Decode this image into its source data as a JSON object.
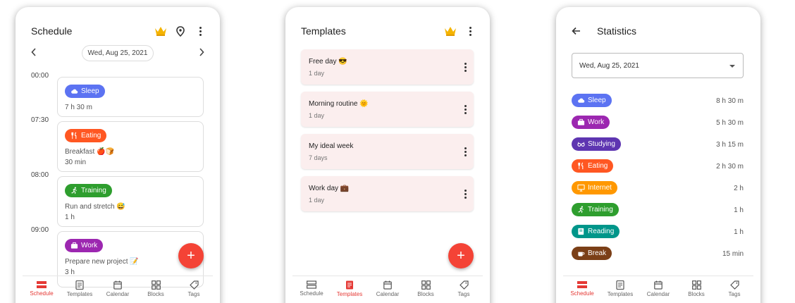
{
  "colors": {
    "accent": "#f44336",
    "crown": "#f5b400"
  },
  "nav": {
    "items": [
      {
        "label": "Schedule",
        "icon": "schedule-icon"
      },
      {
        "label": "Templates",
        "icon": "templates-icon"
      },
      {
        "label": "Calendar",
        "icon": "calendar-icon"
      },
      {
        "label": "Blocks",
        "icon": "blocks-icon"
      },
      {
        "label": "Tags",
        "icon": "tag-icon"
      }
    ]
  },
  "schedule": {
    "title": "Schedule",
    "date": "Wed, Aug 25, 2021",
    "times": [
      "00:00",
      "07:30",
      "08:00",
      "09:00"
    ],
    "blocks": [
      {
        "tag": "Sleep",
        "color": "#5c73f2",
        "icon": "cloud-icon",
        "line1": "7 h 30 m",
        "line2": ""
      },
      {
        "tag": "Eating",
        "color": "#ff5722",
        "icon": "fork-knife-icon",
        "line1": "Breakfast 🍎🍞",
        "line2": "30 min"
      },
      {
        "tag": "Training",
        "color": "#2e9e2e",
        "icon": "runner-icon",
        "line1": "Run and stretch 😅",
        "line2": "1 h"
      },
      {
        "tag": "Work",
        "color": "#9c27b0",
        "icon": "briefcase-icon",
        "line1": "Prepare new project 📝",
        "line2": "3 h"
      }
    ],
    "fab": "+"
  },
  "templates": {
    "title": "Templates",
    "items": [
      {
        "name": "Free day 😎",
        "duration": "1 day"
      },
      {
        "name": "Morning routine 🌞",
        "duration": "1 day"
      },
      {
        "name": "My ideal week",
        "duration": "7 days"
      },
      {
        "name": "Work day 💼",
        "duration": "1 day"
      }
    ],
    "fab": "+"
  },
  "statistics": {
    "title": "Statistics",
    "date": "Wed, Aug 25, 2021",
    "rows": [
      {
        "tag": "Sleep",
        "color": "#5c73f2",
        "icon": "cloud-icon",
        "duration": "8 h 30 m"
      },
      {
        "tag": "Work",
        "color": "#9c27b0",
        "icon": "briefcase-icon",
        "duration": "5 h 30 m"
      },
      {
        "tag": "Studying",
        "color": "#5e35b1",
        "icon": "glasses-icon",
        "duration": "3 h 15 m"
      },
      {
        "tag": "Eating",
        "color": "#ff5722",
        "icon": "fork-knife-icon",
        "duration": "2 h 30 m"
      },
      {
        "tag": "Internet",
        "color": "#ff9800",
        "icon": "monitor-icon",
        "duration": "2 h"
      },
      {
        "tag": "Training",
        "color": "#2e9e2e",
        "icon": "runner-icon",
        "duration": "1 h"
      },
      {
        "tag": "Reading",
        "color": "#00968a",
        "icon": "book-icon",
        "duration": "1 h"
      },
      {
        "tag": "Break",
        "color": "#7b3f17",
        "icon": "coffee-icon",
        "duration": "15 min"
      }
    ]
  }
}
